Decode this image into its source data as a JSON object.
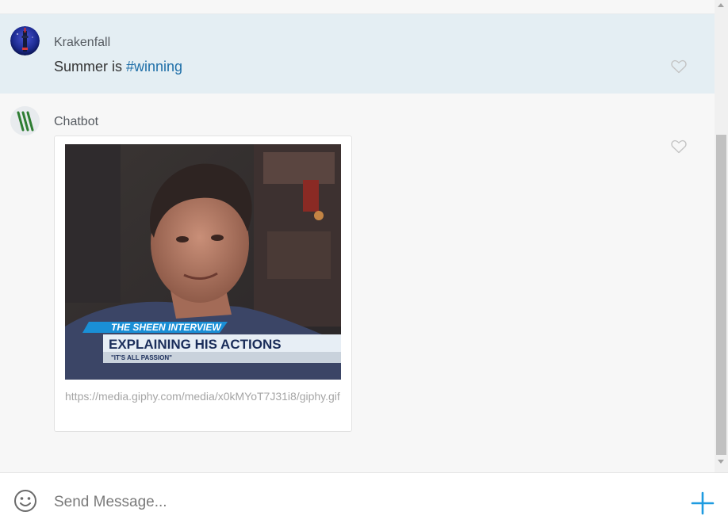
{
  "messages": [
    {
      "username": "Krakenfall",
      "text_plain": "Summer is ",
      "text_hashtag": "#winning",
      "avatar_icon": "user-avatar-blue-tower",
      "highlighted": true
    },
    {
      "username": "Chatbot",
      "avatar_icon": "chatbot-logo-green-slashes",
      "gif": {
        "banner_top": "THE SHEEN INTERVIEW",
        "banner_main": "EXPLAINING HIS ACTIONS",
        "banner_sub": "\"IT'S ALL PASSION\"",
        "url": "https://media.giphy.com/media/x0kMYoT7J31i8/giphy.gif"
      }
    }
  ],
  "composer": {
    "placeholder": "Send Message..."
  },
  "colors": {
    "highlight_bg": "#e4eef3",
    "hashtag": "#1f6fa8",
    "accent_plus": "#1e9be0",
    "chatbot_green": "#2e7d32"
  }
}
